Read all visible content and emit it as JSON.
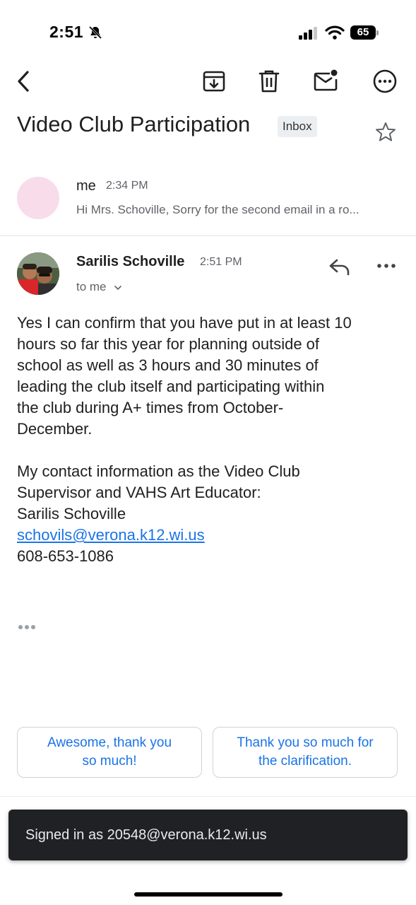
{
  "status_bar": {
    "time": "2:51",
    "battery": "65"
  },
  "thread": {
    "subject": "Video Club Participation",
    "label": "Inbox"
  },
  "collapsed_message": {
    "sender": "me",
    "time": "2:34 PM",
    "snippet": "Hi Mrs. Schoville, Sorry for the second email in a ro..."
  },
  "message": {
    "sender": "Sarilis Schoville",
    "time": "2:51 PM",
    "recipient": "to me",
    "body": {
      "p1": [
        "Yes I can confirm that you have put in at least 10",
        "hours so far this year for planning outside of",
        "school as well as 3 hours and 30 minutes of",
        "leading the club itself and participating within",
        "the club during A+ times from October-",
        "December."
      ],
      "p2": [
        "My contact information as the Video Club",
        "Supervisor and VAHS Art Educator:",
        "Sarilis Schoville"
      ],
      "email": "schovils@verona.k12.wi.us",
      "phone": "608-653-1086"
    }
  },
  "smart_replies": [
    {
      "line1": "Awesome, thank you",
      "line2": "so much!"
    },
    {
      "line1": "Thank you so much for",
      "line2": "the clarification."
    }
  ],
  "snackbar": {
    "text": "Signed in as 20548@verona.k12.wi.us"
  },
  "icons": {
    "back": "chevron-left-icon",
    "archive": "archive-icon",
    "delete": "trash-icon",
    "mark_unread": "mail-unread-icon",
    "more": "more-circle-icon",
    "star": "star-outline-icon",
    "reply": "reply-icon"
  },
  "colors": {
    "link": "#1a73e8",
    "snackbar": "#202124",
    "chip": "#eceff1"
  }
}
